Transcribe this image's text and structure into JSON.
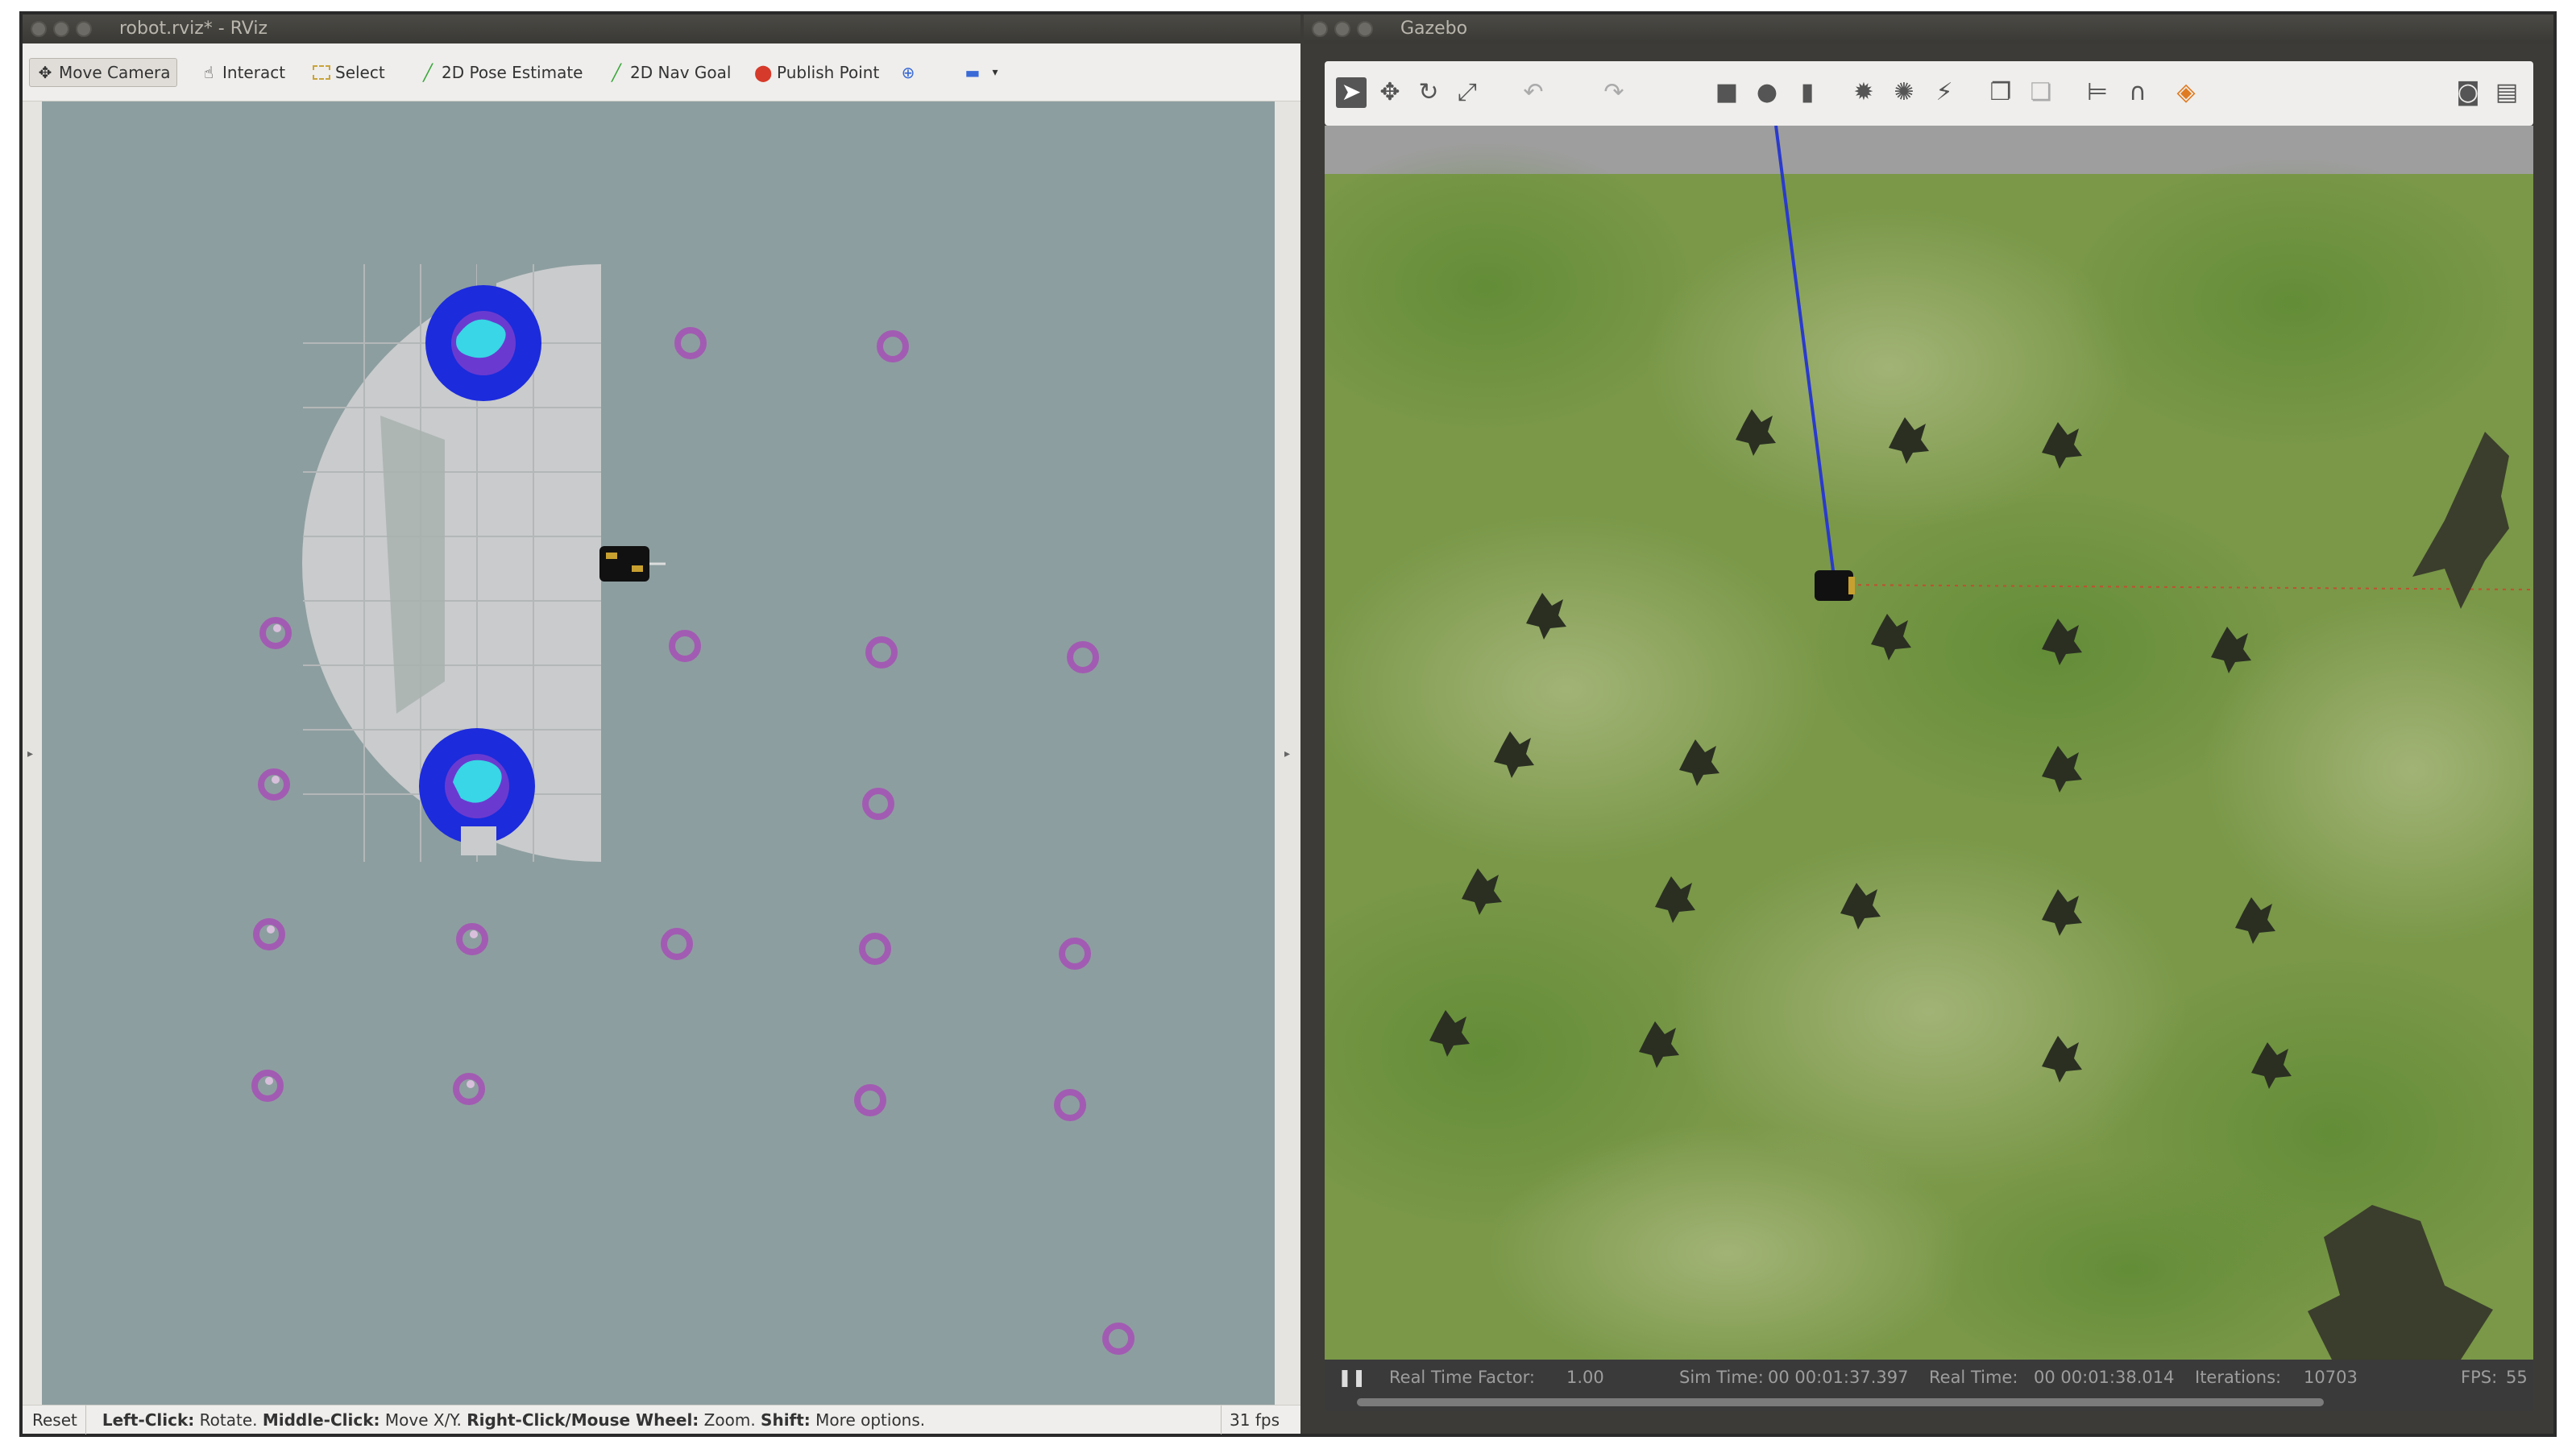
{
  "rviz": {
    "title": "robot.rviz* - RViz",
    "tools": {
      "move_camera": "Move Camera",
      "interact": "Interact",
      "select": "Select",
      "pose_estimate": "2D Pose Estimate",
      "nav_goal": "2D Nav Goal",
      "publish_point": "Publish Point"
    },
    "status": {
      "reset": "Reset",
      "left_key": "Left-Click:",
      "left_val": "Rotate.",
      "middle_key": "Middle-Click:",
      "middle_val": "Move X/Y.",
      "right_key": "Right-Click/Mouse Wheel:",
      "right_val": "Zoom.",
      "shift_key": "Shift:",
      "shift_val": "More options.",
      "fps": "31 fps"
    },
    "colors": {
      "background": "#8d9ea0",
      "obstacle_ring": "#a25bb2",
      "costmap_outer": "#1c2bdc",
      "costmap_inner": "#38d6e6",
      "scan_area": "#c9cbcc"
    }
  },
  "gazebo": {
    "title": "Gazebo",
    "status": {
      "rtf_label": "Real Time Factor:",
      "rtf_value": "1.00",
      "sim_label": "Sim Time:",
      "sim_value": "00 00:01:37.397",
      "real_label": "Real Time:",
      "real_value": "00 00:01:38.014",
      "iter_label": "Iterations:",
      "iter_value": "10703",
      "fps_label": "FPS:",
      "fps_value": "55"
    },
    "colors": {
      "grass": "#6e8f3c",
      "plant": "#2a2f22",
      "sky": "#9e9e9e"
    }
  }
}
